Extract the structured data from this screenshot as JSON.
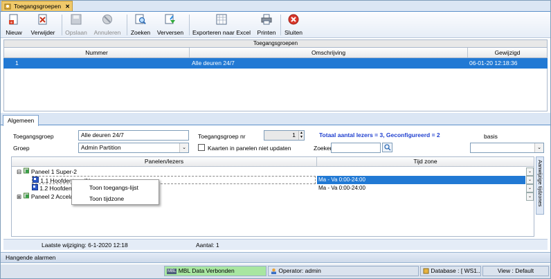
{
  "window_tab": {
    "label": "Toegangsgroepen",
    "close": "✕"
  },
  "toolbar": {
    "nieuw": "Nieuw",
    "verwijder": "Verwijder",
    "opslaan": "Opslaan",
    "annuleren": "Annuleren",
    "zoeken": "Zoeken",
    "verversen": "Verversen",
    "exporteren": "Exporteren naar Excel",
    "printen": "Printen",
    "sluiten": "Sluiten"
  },
  "grid": {
    "title": "Toegangsgroepen",
    "columns": [
      "Nummer",
      "Omschrijving",
      "Gewijzigd"
    ],
    "rows": [
      {
        "nummer": "1",
        "omschrijving": "Alle deuren 24/7",
        "gewijzigd": "06-01-20 12:18:36"
      }
    ]
  },
  "tabs": {
    "algemeen": "Algemeen"
  },
  "form": {
    "toegangsgroep_label": "Toegangsgroep",
    "toegangsgroep_value": "Alle deuren 24/7",
    "toegangsgroep_nr_label": "Toegangsgroep nr",
    "toegangsgroep_nr_value": "1",
    "totaal": "Totaal aantal lezers = 3, Geconfigureerd = 2",
    "basis": "basis",
    "groep_label": "Groep",
    "groep_value": "Admin Partition",
    "kaarten_label": "Kaarten in panelen niet updaten",
    "zoeken_label": "Zoeken",
    "zoeken_value": ""
  },
  "panel_grid": {
    "columns": [
      "Panelen/lezers",
      "Tijd zone"
    ],
    "tree": [
      {
        "label": "Paneel 1 Super-2",
        "toggle": "⊟"
      },
      {
        "label": "1.1 Hoofdentree IN",
        "timezone": "Ma - Va 0:00-24:00",
        "selected": true
      },
      {
        "label": "1.2 Hoofdentree",
        "timezone": "Ma - Va 0:00-24:00"
      },
      {
        "label": "Paneel 2 Accela",
        "toggle": "⊞"
      }
    ],
    "side_button": "Aanwijzige tijdzones"
  },
  "context_menu": {
    "items": [
      "Toon toegangs-lijst",
      "Toon tijdzone"
    ]
  },
  "inner_status": {
    "laatste_wijziging": "Laatste wijziging: 6-1-2020 12:18",
    "aantal": "Aantal: 1"
  },
  "hangende_alarmen": "Hangende alarmen",
  "statusbar": {
    "mbl": "MBL Data Verbonden",
    "mbl_badge": "MBL",
    "operator": "Operator: admin",
    "database": "Database : [ WS1..",
    "view": "View : Default"
  },
  "colors": {
    "selection": "#2179d4",
    "totaal": "#1f3fcf",
    "status_green": "#a8e6a1"
  }
}
